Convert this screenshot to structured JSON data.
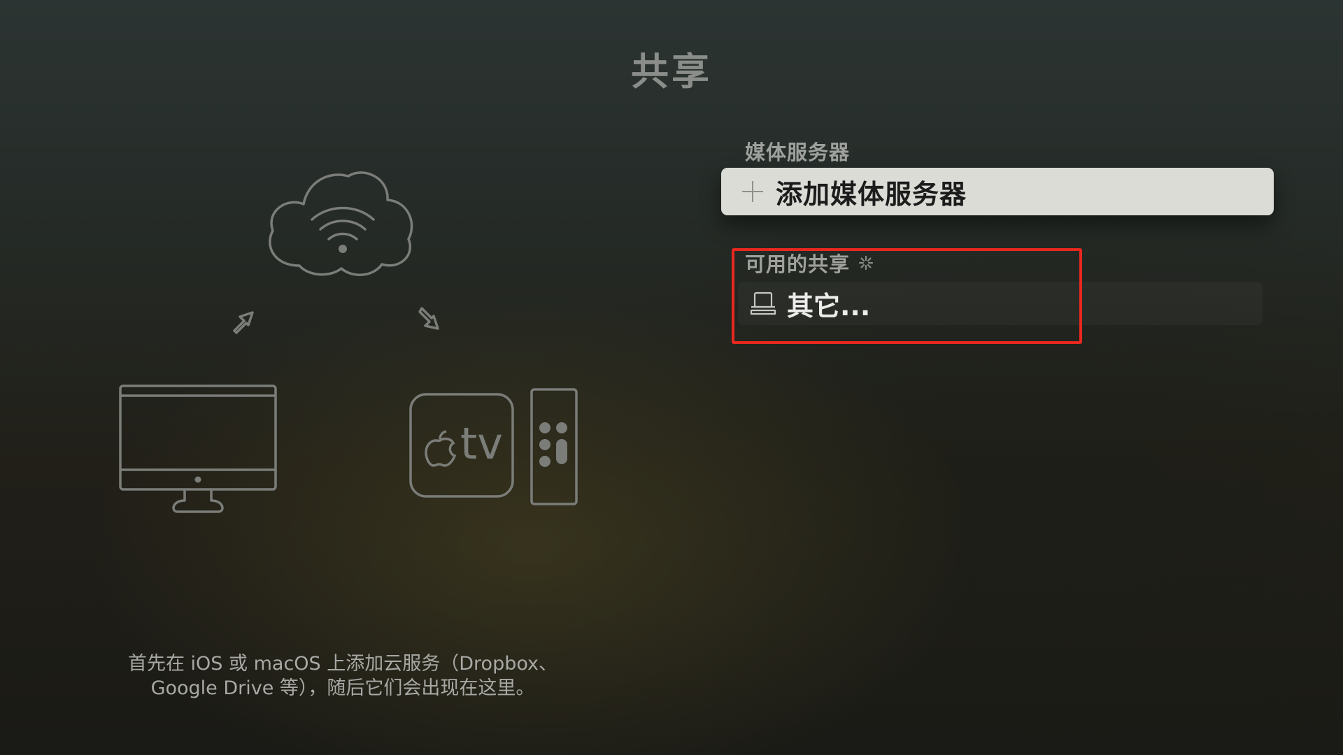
{
  "page": {
    "title": "共享"
  },
  "illustration": {
    "icons": [
      "cloud-wifi-icon",
      "arrow-up-icon",
      "arrow-down-icon",
      "imac-icon",
      "apple-tv-icon",
      "siri-remote-icon"
    ],
    "apple_tv_label": "tv",
    "description_line1": "首先在 iOS 或 macOS 上添加云服务（Dropbox、",
    "description_line2": "Google Drive 等），随后它们会出现在这里。"
  },
  "media_servers": {
    "header": "媒体服务器",
    "add_button_label": "添加媒体服务器",
    "add_button_icon": "plus-icon"
  },
  "available_shares": {
    "header": "可用的共享",
    "loading_icon": "spinner-icon",
    "items": [
      {
        "label": "其它...",
        "icon": "server-icon"
      }
    ]
  },
  "colors": {
    "highlight": "#e8281f",
    "button_background": "#dcdcd7",
    "icon_gray": "#7b7d79"
  }
}
